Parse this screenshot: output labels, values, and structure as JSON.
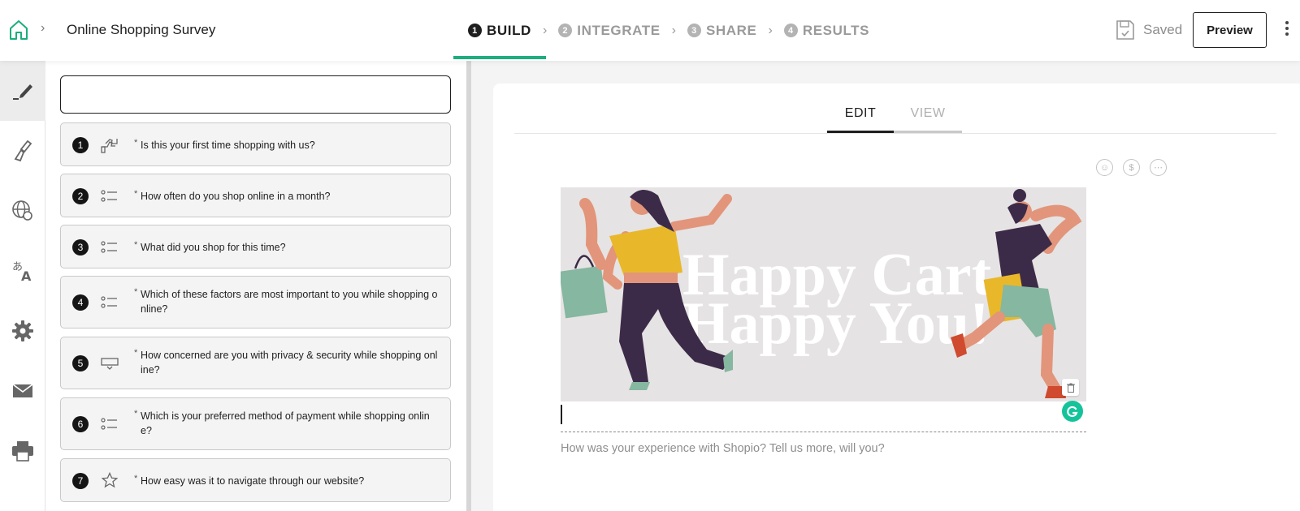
{
  "header": {
    "survey_title": "Online Shopping Survey",
    "steps": [
      {
        "number": "1",
        "label": "BUILD",
        "active": true
      },
      {
        "number": "2",
        "label": "INTEGRATE",
        "active": false
      },
      {
        "number": "3",
        "label": "SHARE",
        "active": false
      },
      {
        "number": "4",
        "label": "RESULTS",
        "active": false
      }
    ],
    "saved_label": "Saved",
    "preview_label": "Preview"
  },
  "rail": {
    "items": [
      "edit-pen-icon",
      "paint-brush-icon",
      "globe-icon",
      "translate-icon",
      "gear-icon",
      "mail-icon",
      "printer-icon"
    ],
    "active": "edit-pen-icon"
  },
  "questions": [
    {
      "number": "1",
      "icon": "thumbs-up-down-icon",
      "text": "Is this your first time shopping with us?"
    },
    {
      "number": "2",
      "icon": "multiple-choice-icon",
      "text": "How often do you shop online in a month?"
    },
    {
      "number": "3",
      "icon": "multiple-choice-icon",
      "text": "What did you shop for this time?"
    },
    {
      "number": "4",
      "icon": "multiple-choice-icon",
      "text": "Which of these factors are most important to you while shopping o nline?"
    },
    {
      "number": "5",
      "icon": "dropdown-icon",
      "text": "How concerned are you with privacy & security while shopping onl ine?"
    },
    {
      "number": "6",
      "icon": "multiple-choice-icon",
      "text": "Which is your preferred method of payment while shopping onlin e?"
    },
    {
      "number": "7",
      "icon": "star-icon",
      "text": "How easy was it to navigate through our website?"
    }
  ],
  "editor": {
    "tabs": {
      "edit": "EDIT",
      "view": "VIEW"
    },
    "active_tab": "EDIT",
    "banner_text_line1": "Happy Cart,",
    "banner_text_line2": "Happy You!",
    "description_placeholder": "How was your experience with Shopio? Tell us more, will you?"
  },
  "colors": {
    "accent_green": "#1cae7e",
    "banner_bg": "#e6e3e4",
    "annotation_arrow": "#e0301e"
  }
}
